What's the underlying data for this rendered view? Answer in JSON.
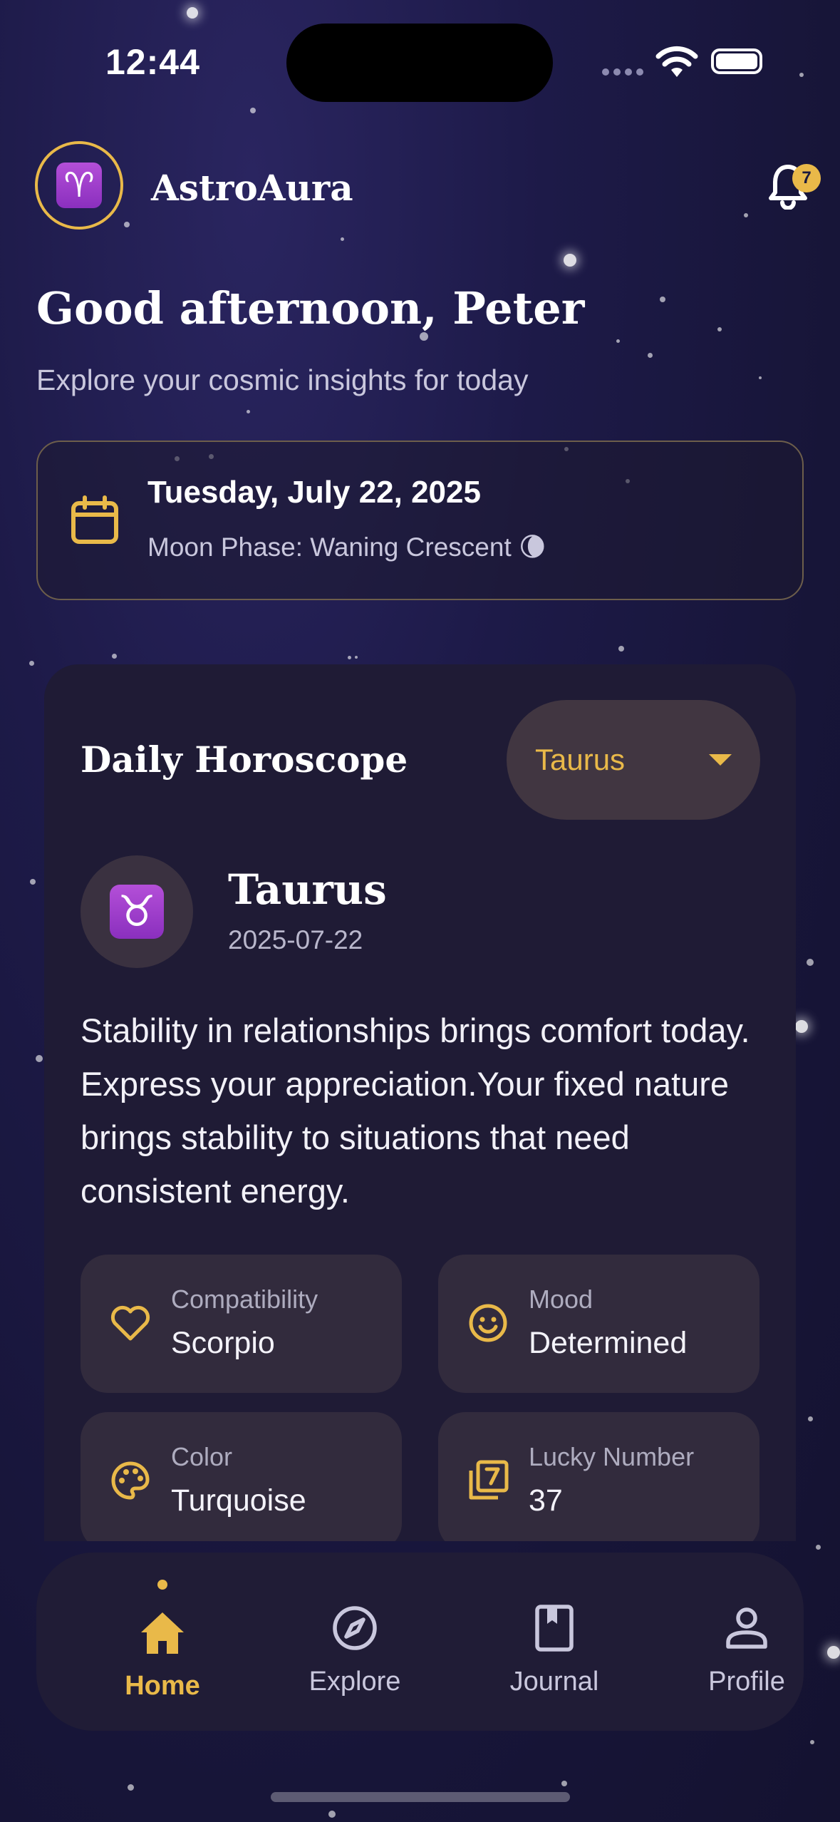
{
  "status_bar": {
    "time": "12:44"
  },
  "header": {
    "app_title": "AstroAura",
    "logo_glyph": "♈",
    "notification_count": "7"
  },
  "greeting": {
    "title": "Good afternoon, Peter",
    "subtitle": "Explore your cosmic insights for today"
  },
  "date_card": {
    "date": "Tuesday, July 22, 2025",
    "moon_phase": "Moon Phase: Waning Crescent 🌘"
  },
  "horoscope": {
    "title": "Daily Horoscope",
    "selected_sign": "Taurus",
    "sign_glyph": "♉",
    "sign_name": "Taurus",
    "sign_date": "2025-07-22",
    "text": "Stability in relationships brings comfort today. Express your appreciation.Your fixed nature brings stability to situations that need consistent energy.",
    "stats": [
      {
        "label": "Compatibility",
        "value": "Scorpio",
        "icon": "heart-icon"
      },
      {
        "label": "Mood",
        "value": "Determined",
        "icon": "smiley-icon"
      },
      {
        "label": "Color",
        "value": "Turquoise",
        "icon": "palette-icon"
      },
      {
        "label": "Lucky Number",
        "value": "37",
        "icon": "number-icon"
      }
    ]
  },
  "nav": {
    "items": [
      {
        "label": "Home",
        "icon": "home-icon",
        "active": true
      },
      {
        "label": "Explore",
        "icon": "compass-icon",
        "active": false
      },
      {
        "label": "Journal",
        "icon": "journal-icon",
        "active": false
      },
      {
        "label": "Profile",
        "icon": "profile-icon",
        "active": false
      }
    ]
  },
  "colors": {
    "accent": "#e9b949",
    "background": "#1d1a48",
    "card": "#1f1b35",
    "tile": "#322b3d"
  }
}
